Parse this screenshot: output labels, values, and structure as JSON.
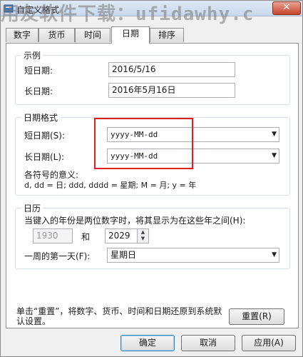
{
  "window": {
    "title": "自定义格式",
    "watermark": "用友软件下载：ufidawhy.c",
    "close_symbol": "✕"
  },
  "tabs": [
    {
      "label": "数字"
    },
    {
      "label": "货币"
    },
    {
      "label": "时间"
    },
    {
      "label": "日期",
      "active": true
    },
    {
      "label": "排序"
    }
  ],
  "example": {
    "title": "示例",
    "short_label": "短日期:",
    "short_value": "2016/5/16",
    "long_label": "长日期:",
    "long_value": "2016年5月16日"
  },
  "date_format": {
    "title": "日期格式",
    "short_label": "短日期(S):",
    "short_value": "yyyy-MM-dd",
    "long_label": "长日期(L):",
    "long_value": "yyyy-MM-dd",
    "meaning_label": "各符号的意义:",
    "meaning_text": "d, dd = 日;  ddd, dddd = 星期;  M = 月;  y = 年",
    "highlight_color": "#e02020"
  },
  "calendar": {
    "title": "日历",
    "two_digit_text": "当键入的年份是两位数字时，将其显示为在这些年之间(H):",
    "year_from": "1930",
    "and_label": "和",
    "year_to": "2029",
    "first_day_label": "一周的第一天(F):",
    "first_day_value": "星期日"
  },
  "reset": {
    "description": "单击“重置”，将数字、货币、时间和日期还原到系统默认设置。",
    "button": "重置(R)"
  },
  "footer": {
    "ok": "确定",
    "cancel": "取消",
    "apply": "应用(A)"
  }
}
